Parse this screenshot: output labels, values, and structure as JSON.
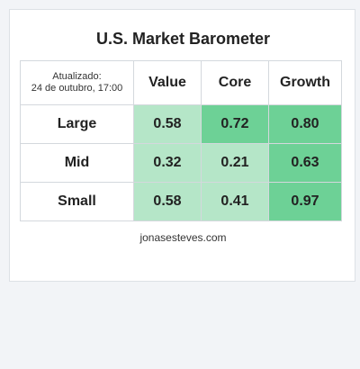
{
  "title": "U.S. Market Barometer",
  "updated": {
    "label": "Atualizado:",
    "date": "24 de outubro, 17:00"
  },
  "columns": [
    "Value",
    "Core",
    "Growth"
  ],
  "rows": [
    {
      "label": "Large",
      "values": [
        "0.58",
        "0.72",
        "0.80"
      ],
      "colors": [
        "#b5e6c8",
        "#6dd196",
        "#6dd196"
      ]
    },
    {
      "label": "Mid",
      "values": [
        "0.32",
        "0.21",
        "0.63"
      ],
      "colors": [
        "#b5e6c8",
        "#b5e6c8",
        "#6dd196"
      ]
    },
    {
      "label": "Small",
      "values": [
        "0.58",
        "0.41",
        "0.97"
      ],
      "colors": [
        "#b5e6c8",
        "#b5e6c8",
        "#6dd196"
      ]
    }
  ],
  "footer": "jonasesteves.com"
}
